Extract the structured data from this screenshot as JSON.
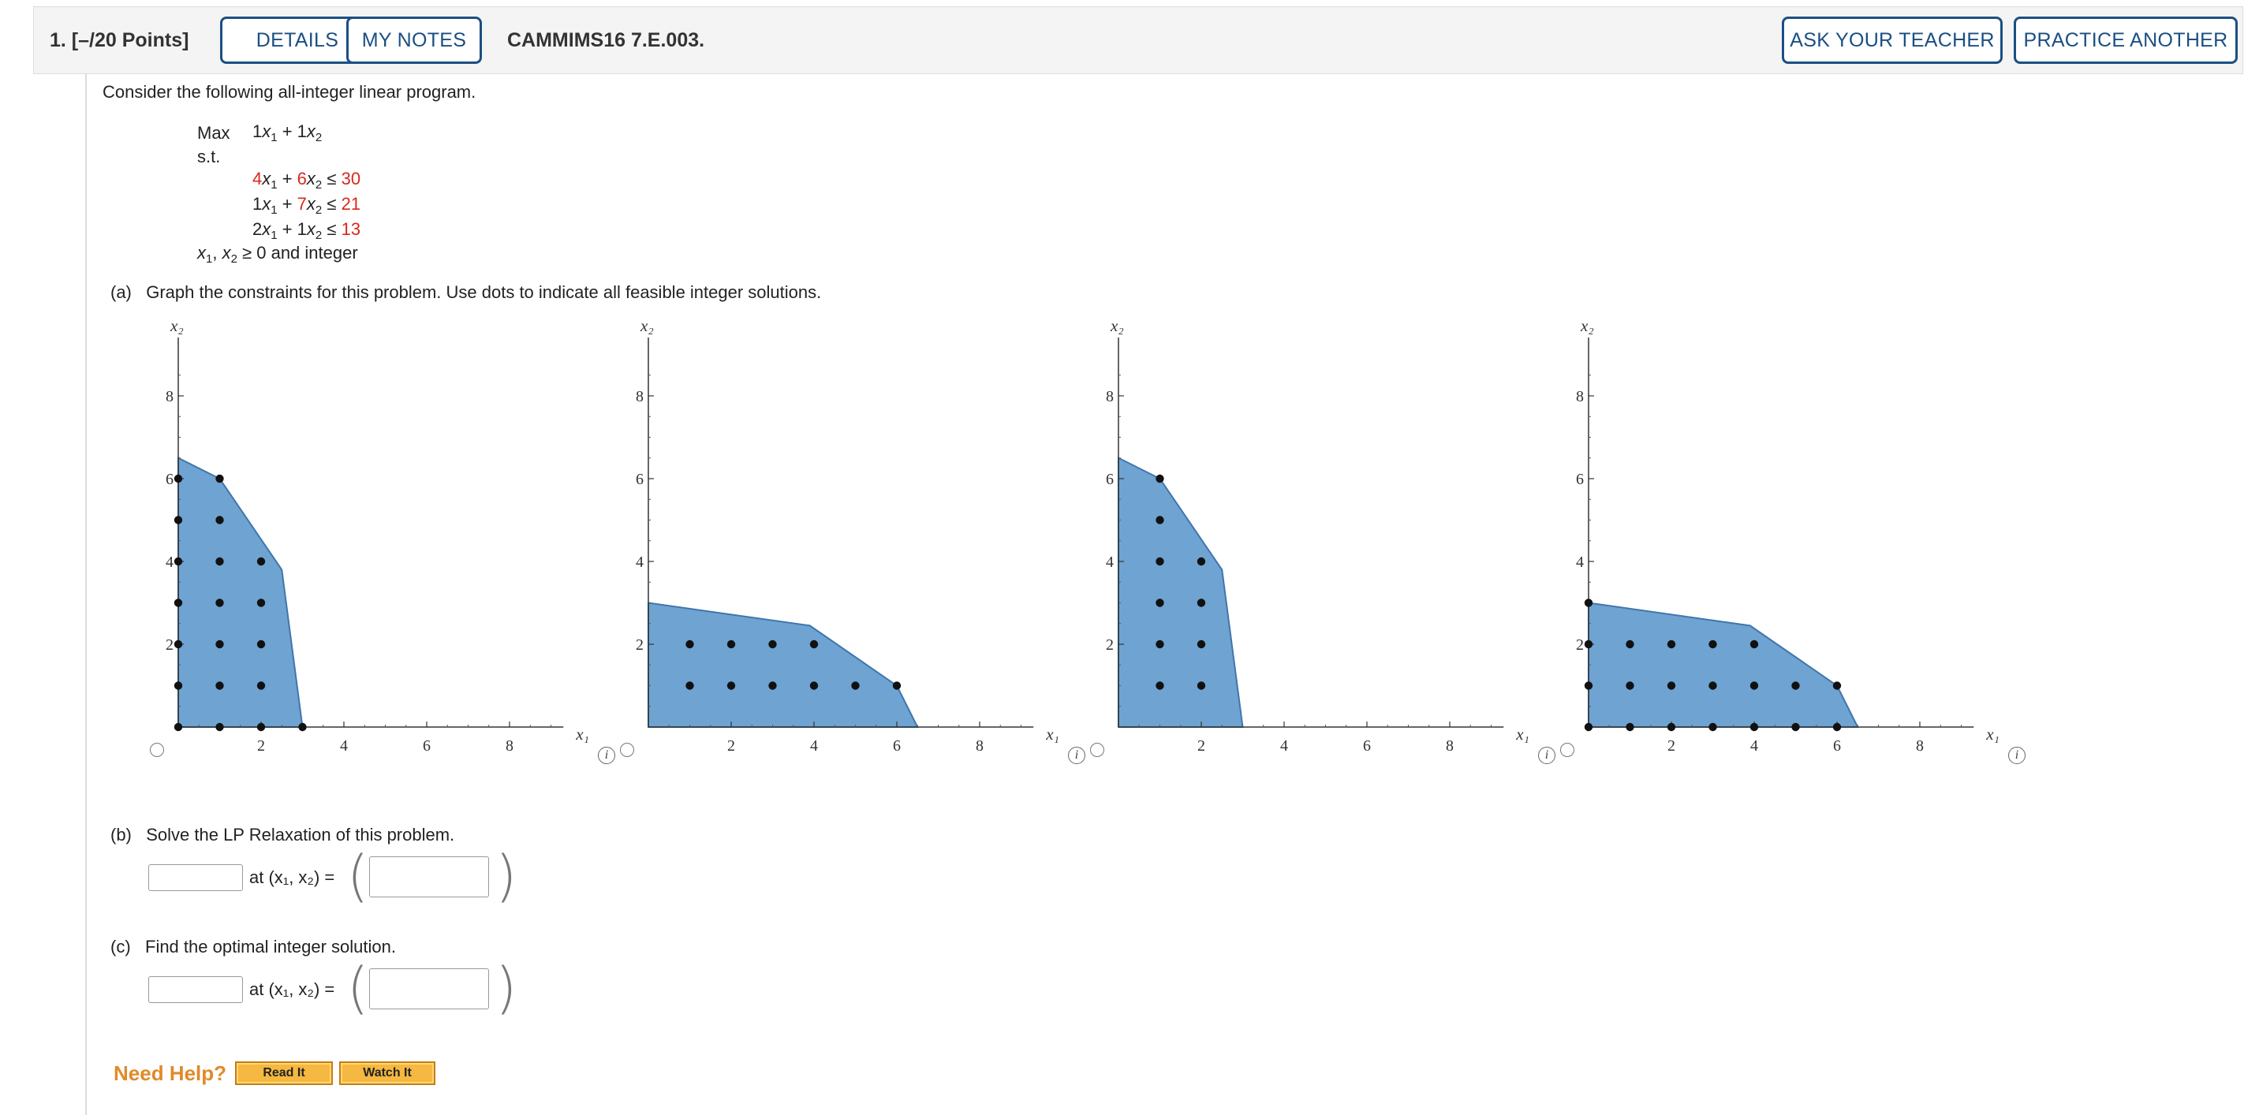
{
  "header": {
    "question_number": "1.  [–/20 Points]",
    "details_label": "DETAILS",
    "notes_label": "MY NOTES",
    "code": "CAMMIMS16 7.E.003.",
    "ask_teacher_label": "ASK YOUR TEACHER",
    "practice_label": "PRACTICE ANOTHER"
  },
  "problem": {
    "intro": "Consider the following all-integer linear program.",
    "max_label": "Max",
    "st_label": "s.t.",
    "objective": {
      "c1": "1",
      "c2": "1"
    },
    "constraints": [
      {
        "a": "4",
        "b": "6",
        "rhs": "30",
        "a_red": true,
        "b_red": true
      },
      {
        "a": "1",
        "b": "7",
        "rhs": "21",
        "a_red": false,
        "b_red": true
      },
      {
        "a": "2",
        "b": "1",
        "rhs": "13",
        "a_red": false,
        "b_red": false
      }
    ],
    "nonneg": "≥ 0 and integer"
  },
  "part_a": {
    "label": "(a)",
    "text": "Graph the constraints for this problem. Use dots to indicate all feasible integer solutions."
  },
  "graphs": [
    {
      "xlabel": "x₁",
      "ylabel": "x₂",
      "x_ticks": [
        2,
        4,
        6,
        8
      ],
      "y_ticks": [
        2,
        4,
        6,
        8
      ],
      "region": [
        [
          0,
          0
        ],
        [
          0,
          6.5
        ],
        [
          1,
          6
        ],
        [
          2.5,
          3.8
        ],
        [
          3,
          0
        ]
      ],
      "points": [
        [
          0,
          0
        ],
        [
          0,
          1
        ],
        [
          0,
          2
        ],
        [
          0,
          3
        ],
        [
          0,
          4
        ],
        [
          0,
          5
        ],
        [
          0,
          6
        ],
        [
          1,
          0
        ],
        [
          1,
          1
        ],
        [
          1,
          2
        ],
        [
          1,
          3
        ],
        [
          1,
          4
        ],
        [
          1,
          5
        ],
        [
          1,
          6
        ],
        [
          2,
          0
        ],
        [
          2,
          1
        ],
        [
          2,
          2
        ],
        [
          2,
          3
        ],
        [
          2,
          4
        ],
        [
          3,
          0
        ]
      ]
    },
    {
      "xlabel": "x₁",
      "ylabel": "x₂",
      "x_ticks": [
        2,
        4,
        6,
        8
      ],
      "y_ticks": [
        2,
        4,
        6,
        8
      ],
      "region": [
        [
          0,
          0
        ],
        [
          0,
          3
        ],
        [
          3.9,
          2.45
        ],
        [
          6,
          1
        ],
        [
          6.5,
          0
        ]
      ],
      "points": [
        [
          1,
          1
        ],
        [
          1,
          2
        ],
        [
          2,
          1
        ],
        [
          2,
          2
        ],
        [
          3,
          1
        ],
        [
          3,
          2
        ],
        [
          4,
          1
        ],
        [
          4,
          2
        ],
        [
          5,
          1
        ],
        [
          6,
          1
        ]
      ]
    },
    {
      "xlabel": "x₁",
      "ylabel": "x₂",
      "x_ticks": [
        2,
        4,
        6,
        8
      ],
      "y_ticks": [
        2,
        4,
        6,
        8
      ],
      "region": [
        [
          0,
          0
        ],
        [
          0,
          6.5
        ],
        [
          1,
          6
        ],
        [
          2.5,
          3.8
        ],
        [
          3,
          0
        ]
      ],
      "points": [
        [
          1,
          1
        ],
        [
          1,
          2
        ],
        [
          1,
          3
        ],
        [
          1,
          4
        ],
        [
          1,
          5
        ],
        [
          1,
          6
        ],
        [
          2,
          1
        ],
        [
          2,
          2
        ],
        [
          2,
          3
        ],
        [
          2,
          4
        ]
      ]
    },
    {
      "xlabel": "x₁",
      "ylabel": "x₂",
      "x_ticks": [
        2,
        4,
        6,
        8
      ],
      "y_ticks": [
        2,
        4,
        6,
        8
      ],
      "region": [
        [
          0,
          0
        ],
        [
          0,
          3
        ],
        [
          3.9,
          2.45
        ],
        [
          6,
          1
        ],
        [
          6.5,
          0
        ]
      ],
      "points": [
        [
          0,
          0
        ],
        [
          0,
          1
        ],
        [
          0,
          2
        ],
        [
          0,
          3
        ],
        [
          1,
          0
        ],
        [
          1,
          1
        ],
        [
          1,
          2
        ],
        [
          2,
          0
        ],
        [
          2,
          1
        ],
        [
          2,
          2
        ],
        [
          3,
          0
        ],
        [
          3,
          1
        ],
        [
          3,
          2
        ],
        [
          4,
          0
        ],
        [
          4,
          1
        ],
        [
          4,
          2
        ],
        [
          5,
          0
        ],
        [
          5,
          1
        ],
        [
          6,
          0
        ],
        [
          6,
          1
        ]
      ]
    }
  ],
  "part_b": {
    "label": "(b)",
    "text": "Solve the LP Relaxation of this problem.",
    "at_text": "at (x₁, x₂) ="
  },
  "part_c": {
    "label": "(c)",
    "text": "Find the optimal integer solution.",
    "at_text": "at (x₁, x₂) ="
  },
  "help": {
    "label": "Need Help?",
    "read_label": "Read It",
    "watch_label": "Watch It"
  },
  "colors": {
    "region_fill": "#6fa3d1",
    "region_stroke": "#3f76ad",
    "button_border": "#1b4f83",
    "constraint_red": "#d9281f",
    "help_orange": "#e08a2a"
  }
}
